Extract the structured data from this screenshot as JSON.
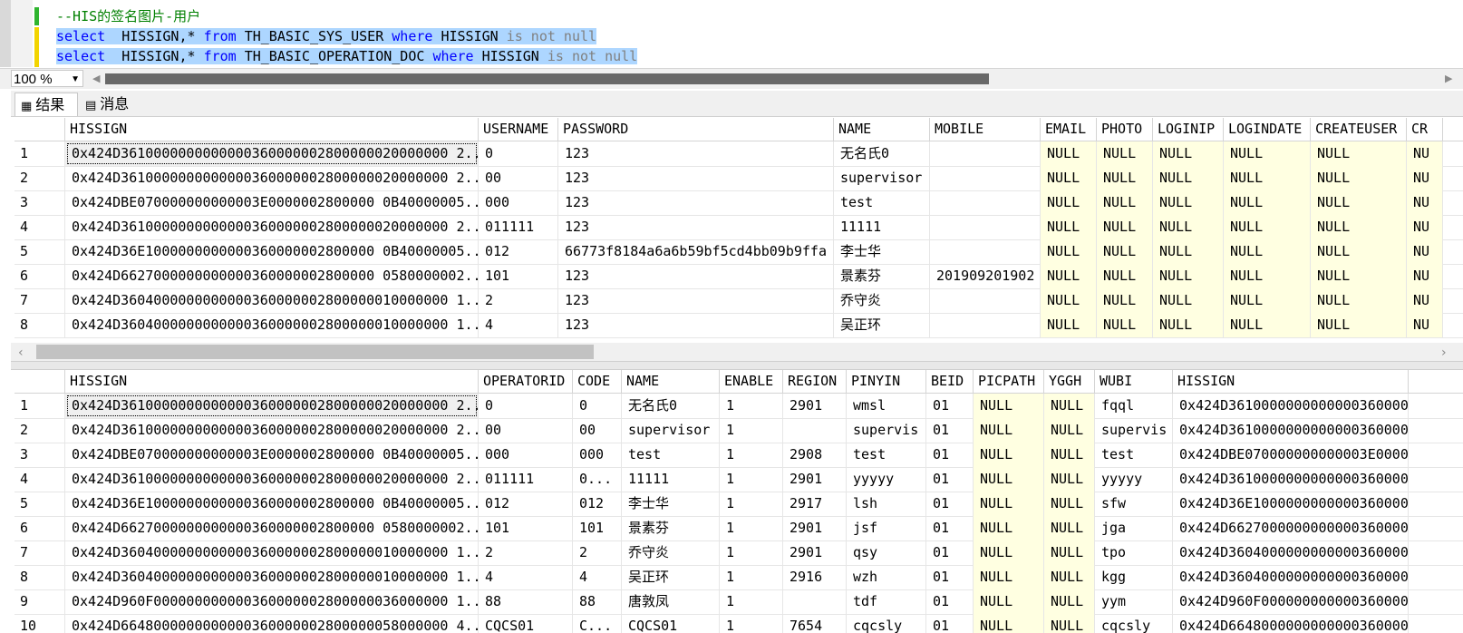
{
  "editor": {
    "lines": [
      {
        "text": "--HIS的签名图片-用户"
      },
      {
        "kw1": "select",
        "mid1": "  HISSIGN,* ",
        "kw2": "from",
        "mid2": " TH_BASIC_SYS_USER ",
        "kw3": "where",
        "mid3": " HISSIGN ",
        "tail": "is not null"
      },
      {
        "kw1": "select",
        "mid1": "  HISSIGN,* ",
        "kw2": "from",
        "mid2": " TH_BASIC_OPERATION_DOC ",
        "kw3": "where",
        "mid3": " HISSIGN ",
        "tail": "is not null"
      }
    ]
  },
  "zoom": {
    "value": "100 %"
  },
  "result_tabs": [
    {
      "label": "结果",
      "icon": "grid-icon"
    },
    {
      "label": "消息",
      "icon": "messages-icon"
    }
  ],
  "grid1": {
    "columns": [
      "HISSIGN",
      "USERNAME",
      "PASSWORD",
      "NAME",
      "MOBILE",
      "EMAIL",
      "PHOTO",
      "LOGINIP",
      "LOGINDATE",
      "CREATEUSER",
      "CR"
    ],
    "rows": [
      {
        "num": "1",
        "cells": [
          "0x424D3610000000000000360000002800000020000000 2...",
          "0",
          "123",
          "无名氏0",
          "",
          "NULL",
          "NULL",
          "NULL",
          "NULL",
          "NULL",
          "NU"
        ]
      },
      {
        "num": "2",
        "cells": [
          "0x424D3610000000000000360000002800000020000000 2...",
          "00",
          "123",
          "supervisor",
          "",
          "NULL",
          "NULL",
          "NULL",
          "NULL",
          "NULL",
          "NU"
        ]
      },
      {
        "num": "3",
        "cells": [
          "0x424DBE070000000000003E0000002800000 0B40000005...",
          "000",
          "123",
          "test",
          "",
          "NULL",
          "NULL",
          "NULL",
          "NULL",
          "NULL",
          "NU"
        ]
      },
      {
        "num": "4",
        "cells": [
          "0x424D3610000000000000360000002800000020000000 2...",
          "011111",
          "123",
          "11111",
          "",
          "NULL",
          "NULL",
          "NULL",
          "NULL",
          "NULL",
          "NU"
        ]
      },
      {
        "num": "5",
        "cells": [
          "0x424D36E1000000000000360000002800000 0B40000005...",
          "012",
          "66773f8184a6a6b59bf5cd4bb09b9ffa",
          "李士华",
          "",
          "NULL",
          "NULL",
          "NULL",
          "NULL",
          "NULL",
          "NU"
        ]
      },
      {
        "num": "6",
        "cells": [
          "0x424D6627000000000000360000002800000 0580000002...",
          "101",
          "123",
          "景素芬",
          "201909201902",
          "NULL",
          "NULL",
          "NULL",
          "NULL",
          "NULL",
          "NU"
        ]
      },
      {
        "num": "7",
        "cells": [
          "0x424D3604000000000000360000002800000010000000 1...",
          "2",
          "123",
          "乔守炎",
          "",
          "NULL",
          "NULL",
          "NULL",
          "NULL",
          "NULL",
          "NU"
        ]
      },
      {
        "num": "8",
        "cells": [
          "0x424D3604000000000000360000002800000010000000 1...",
          "4",
          "123",
          "吴正环",
          "",
          "NULL",
          "NULL",
          "NULL",
          "NULL",
          "NULL",
          "NU"
        ]
      }
    ]
  },
  "grid2": {
    "columns": [
      "HISSIGN",
      "OPERATORID",
      "CODE",
      "NAME",
      "ENABLE",
      "REGION",
      "PINYIN",
      "BEID",
      "PICPATH",
      "YGGH",
      "WUBI",
      "HISSIGN"
    ],
    "rows": [
      {
        "num": "1",
        "cells": [
          "0x424D3610000000000000360000002800000020000000 2...",
          "0",
          "0",
          "无名氏0",
          "1",
          "2901",
          "wmsl",
          "01",
          "NULL",
          "NULL",
          "fqql",
          "0x424D36100000000000003600000"
        ]
      },
      {
        "num": "2",
        "cells": [
          "0x424D3610000000000000360000002800000020000000 2...",
          "00",
          "00",
          "supervisor",
          "1",
          "",
          "supervis",
          "01",
          "NULL",
          "NULL",
          "supervis",
          "0x424D36100000000000003600000"
        ]
      },
      {
        "num": "3",
        "cells": [
          "0x424DBE070000000000003E0000002800000 0B40000005...",
          "000",
          "000",
          "test",
          "1",
          "2908",
          "test",
          "01",
          "NULL",
          "NULL",
          "test",
          "0x424DBE070000000000003E00000"
        ]
      },
      {
        "num": "4",
        "cells": [
          "0x424D3610000000000000360000002800000020000000 2...",
          "011111",
          "0...",
          "11111",
          "1",
          "2901",
          "yyyyy",
          "01",
          "NULL",
          "NULL",
          "yyyyy",
          "0x424D36100000000000003600000"
        ]
      },
      {
        "num": "5",
        "cells": [
          "0x424D36E1000000000000360000002800000 0B40000005...",
          "012",
          "012",
          "李士华",
          "1",
          "2917",
          "lsh",
          "01",
          "NULL",
          "NULL",
          "sfw",
          "0x424D36E10000000000003600000"
        ]
      },
      {
        "num": "6",
        "cells": [
          "0x424D6627000000000000360000002800000 0580000002...",
          "101",
          "101",
          "景素芬",
          "1",
          "2901",
          "jsf",
          "01",
          "NULL",
          "NULL",
          "jga",
          "0x424D66270000000000003600000"
        ]
      },
      {
        "num": "7",
        "cells": [
          "0x424D3604000000000000360000002800000010000000 1...",
          "2",
          "2",
          "乔守炎",
          "1",
          "2901",
          "qsy",
          "01",
          "NULL",
          "NULL",
          "tpo",
          "0x424D36040000000000003600000"
        ]
      },
      {
        "num": "8",
        "cells": [
          "0x424D3604000000000000360000002800000010000000 1...",
          "4",
          "4",
          "吴正环",
          "1",
          "2916",
          "wzh",
          "01",
          "NULL",
          "NULL",
          "kgg",
          "0x424D36040000000000003600000"
        ]
      },
      {
        "num": "9",
        "cells": [
          "0x424D960F000000000000360000002800000036000000 1...",
          "88",
          "88",
          "唐敦凤",
          "1",
          "",
          "tdf",
          "01",
          "NULL",
          "NULL",
          "yym",
          "0x424D960F0000000000003600000"
        ]
      },
      {
        "num": "10",
        "cells": [
          "0x424D6648000000000000360000002800000058000000 4...",
          "CQCS01",
          "C...",
          "CQCS01",
          "1",
          "7654",
          "cqcsly",
          "01",
          "NULL",
          "NULL",
          "cqcsly",
          "0x424D66480000000000003600000"
        ]
      }
    ]
  },
  "colors": {
    "selection": "#add6ff",
    "keyword": "#0000ff",
    "comment": "#008000",
    "null_bg": "#ffffe1"
  }
}
